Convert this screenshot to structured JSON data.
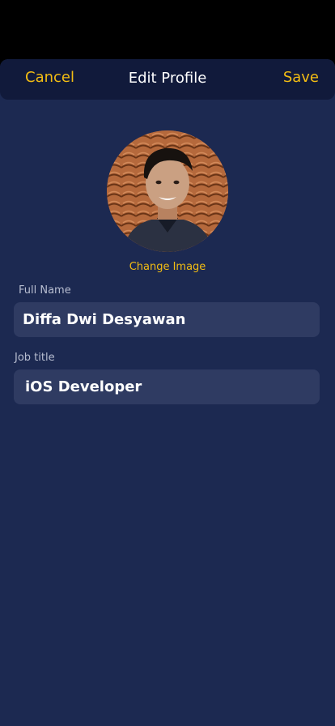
{
  "nav": {
    "cancel_label": "Cancel",
    "title": "Edit Profile",
    "save_label": "Save"
  },
  "profile": {
    "avatar_icon": "profile-photo",
    "change_image_label": "Change Image"
  },
  "form": {
    "full_name": {
      "label": "Full Name",
      "value": "Diffa Dwi Desyawan"
    },
    "job_title": {
      "label": "Job title",
      "value": "iOS Developer"
    }
  },
  "colors": {
    "accent": "#f3bd13",
    "background": "#1c2951",
    "navbar": "#111a3b",
    "field": "#2f3b62"
  }
}
